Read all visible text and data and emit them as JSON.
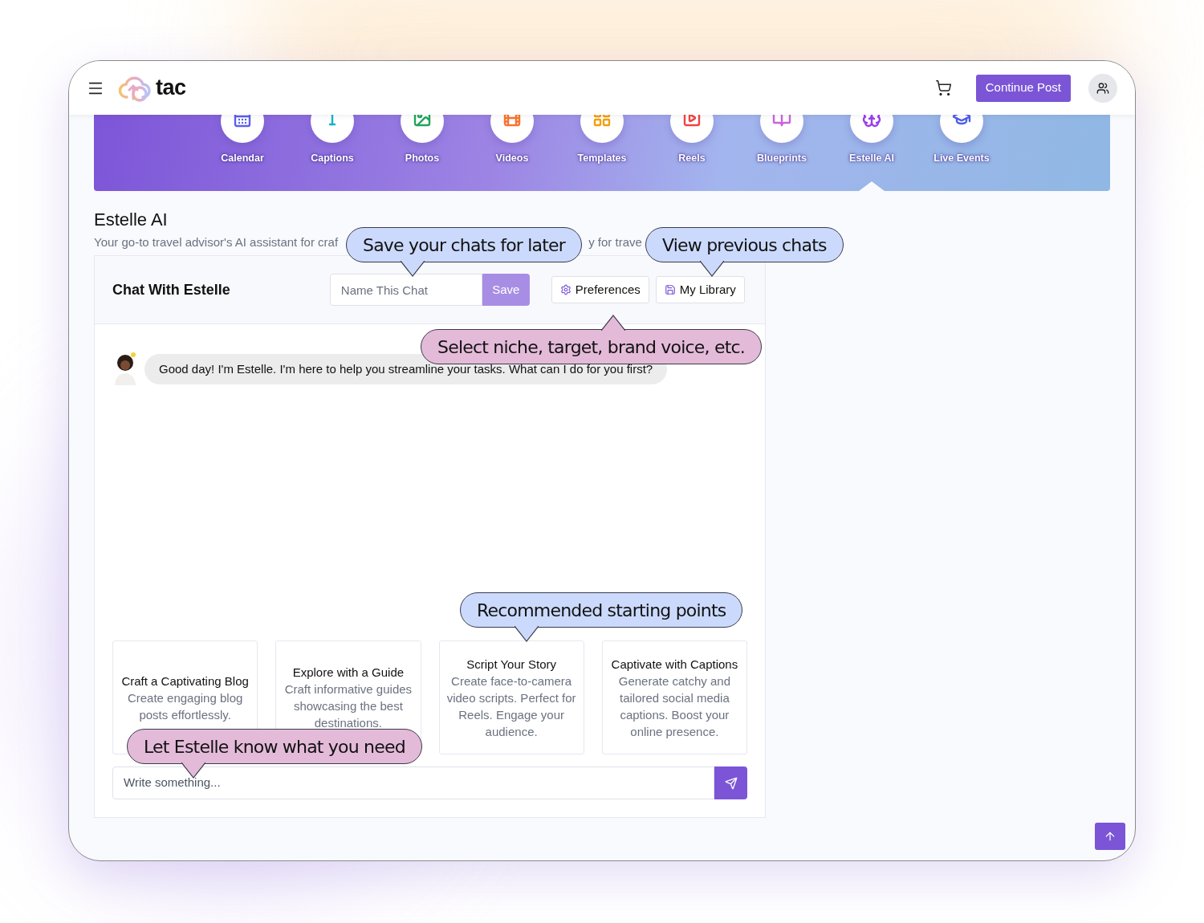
{
  "header": {
    "logo_text": "tac",
    "primary_button": "Continue Post"
  },
  "nav": [
    {
      "label": "Calendar",
      "kind": "calendar",
      "selected": false
    },
    {
      "label": "Captions",
      "kind": "captions",
      "selected": false
    },
    {
      "label": "Photos",
      "kind": "photos",
      "selected": false
    },
    {
      "label": "Videos",
      "kind": "videos",
      "selected": false
    },
    {
      "label": "Templates",
      "kind": "templates",
      "selected": false
    },
    {
      "label": "Reels",
      "kind": "reels",
      "selected": false
    },
    {
      "label": "Blueprints",
      "kind": "blueprints",
      "selected": false
    },
    {
      "label": "Estelle AI",
      "kind": "ai",
      "selected": true
    },
    {
      "label": "Live Events",
      "kind": "events",
      "selected": false
    }
  ],
  "page": {
    "title": "Estelle AI",
    "subtitle_parts": [
      "Your go-to travel advisor's AI assistant for craf",
      "y for trave"
    ]
  },
  "chat": {
    "title": "Chat With Estelle",
    "name_field": {
      "placeholder": "Name This Chat"
    },
    "save_button": "Save",
    "buttons": [
      {
        "label": "Preferences",
        "kind": "settings"
      },
      {
        "label": "My Library",
        "kind": "library"
      }
    ],
    "messages": [
      {
        "text": "Good day! I'm Estelle. I'm here to help you streamline your tasks. What can I do for you first?"
      }
    ],
    "suggestions": [
      {
        "title": "Craft a Captivating Blog",
        "description": "Create engaging blog posts effortlessly."
      },
      {
        "title": "Explore with a Guide",
        "description": "Craft informative guides showcasing the best destinations."
      },
      {
        "title": "Script Your Story",
        "description": "Create face-to-camera video scripts. Perfect for Reels. Engage your audience."
      },
      {
        "title": "Captivate with Captions",
        "description": "Generate catchy and tailored social media captions. Boost your online presence."
      }
    ],
    "composer": {
      "placeholder": "Write something..."
    }
  },
  "callouts": [
    {
      "text": "Save your chats for later",
      "color": "#cbdafc"
    },
    {
      "text": "View previous chats",
      "color": "#cbdafc"
    },
    {
      "text": "Select niche, target, brand voice, etc.",
      "color": "#e4bad9"
    },
    {
      "text": "Recommended starting points",
      "color": "#cbdafc"
    },
    {
      "text": "Let Estelle know what you need",
      "color": "#e4bad9"
    }
  ]
}
